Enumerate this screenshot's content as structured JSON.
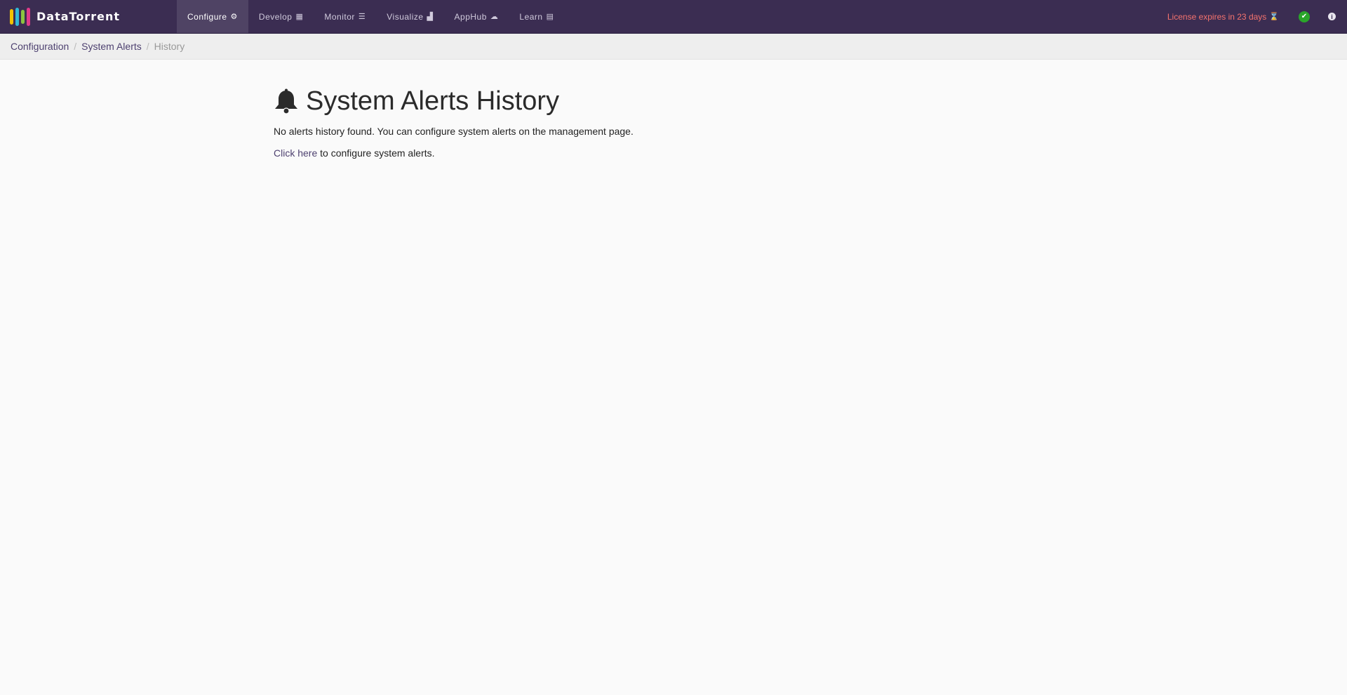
{
  "brand": {
    "name": "DataTorrent"
  },
  "nav": [
    {
      "label": "Configure",
      "icon": "gear-icon",
      "glyph": "⚙",
      "active": true
    },
    {
      "label": "Develop",
      "icon": "grid-icon",
      "glyph": "▦"
    },
    {
      "label": "Monitor",
      "icon": "list-icon",
      "glyph": "☰"
    },
    {
      "label": "Visualize",
      "icon": "bar-chart-icon",
      "glyph": "▟"
    },
    {
      "label": "AppHub",
      "icon": "cloud-icon",
      "glyph": "☁"
    },
    {
      "label": "Learn",
      "icon": "book-icon",
      "glyph": "▤"
    }
  ],
  "license": {
    "text": "License expires in 23 days",
    "icon": "hourglass-icon",
    "glyph": "⌛",
    "color": "#f5736e"
  },
  "status": {
    "icon": "check-circle-icon",
    "glyph": "✔",
    "color": "#2aa52a"
  },
  "info": {
    "icon": "info-icon",
    "glyph": "i"
  },
  "breadcrumb": {
    "item1": "Configuration",
    "item2": "System Alerts",
    "current": "History"
  },
  "page": {
    "title": "System Alerts History",
    "message": "No alerts history found. You can configure system alerts on the management page.",
    "link_text": "Click here",
    "link_suffix": " to configure system alerts."
  },
  "colors": {
    "navbar": "#3b2d52",
    "link": "#4e4170",
    "background": "#fafafa"
  }
}
